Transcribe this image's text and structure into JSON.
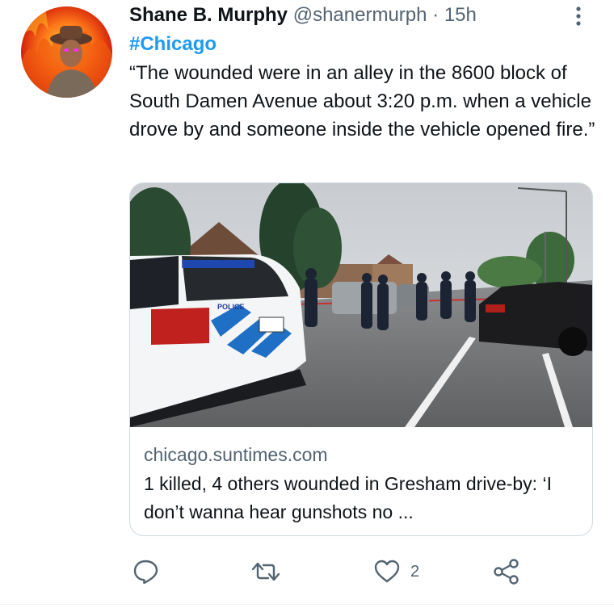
{
  "tweet": {
    "author_name": "Shane B. Murphy",
    "handle": "@shanermurph",
    "separator": "·",
    "time": "15h",
    "hashtag": "#Chicago",
    "text": "“The wounded were in an alley in the 8600 block of South Damen Avenue about 3:20 p.m. when a vehicle drove by and someone inside the vehicle opened fire.”",
    "more_icon": "more-vertical-icon"
  },
  "card": {
    "image_icon": "photo-police-scene",
    "domain": "chicago.suntimes.com",
    "title": "1 killed, 4 others wounded in Gresham drive-by: ‘I don’t wanna hear gunshots no ..."
  },
  "actions": {
    "reply_icon": "reply-icon",
    "retweet_icon": "retweet-icon",
    "like_icon": "heart-icon",
    "like_count": "2",
    "share_icon": "share-icon"
  },
  "colors": {
    "link_blue": "#1d9bf0",
    "secondary_text": "#536471",
    "border": "#cfd9de"
  }
}
